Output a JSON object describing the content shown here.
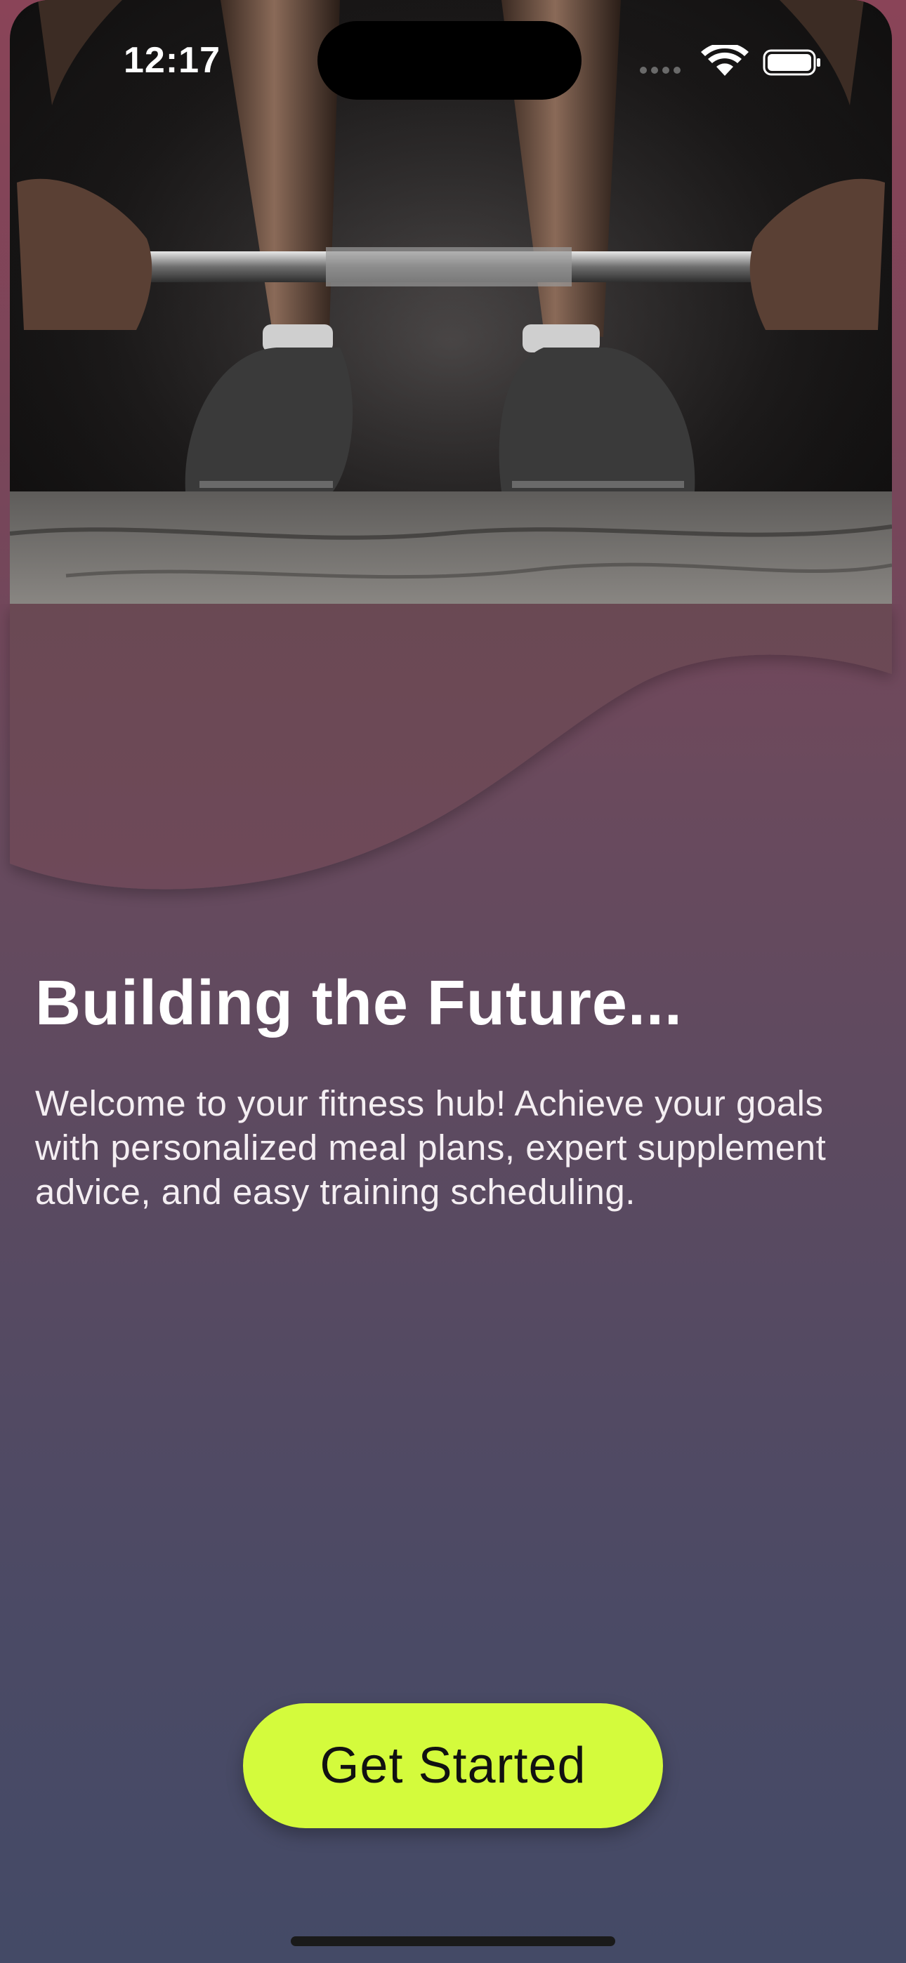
{
  "status_bar": {
    "time": "12:17",
    "icons": [
      "signal-dots-icon",
      "wifi-icon",
      "battery-icon"
    ]
  },
  "hero": {
    "image": "weightlifter-barbell-photo"
  },
  "content": {
    "headline": "Building the Future...",
    "body": "Welcome to your fitness hub! Achieve your goals with personalized meal plans, expert supplement advice, and easy training scheduling."
  },
  "cta": {
    "label": "Get Started"
  },
  "colors": {
    "accent": "#d4fb3c",
    "background_top": "#8a4458",
    "background_bottom": "#444a66"
  }
}
